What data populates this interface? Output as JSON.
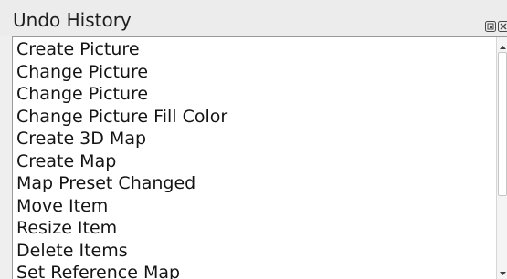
{
  "panel": {
    "title": "Undo History",
    "float_icon": "float-icon",
    "close_icon": "close-icon"
  },
  "history": {
    "items": [
      "Create Picture",
      "Change Picture",
      "Change Picture",
      "Change Picture Fill Color",
      "Create 3D Map",
      "Create Map",
      "Map Preset Changed",
      "Move Item",
      "Resize Item",
      "Delete Items",
      "Set Reference Map"
    ]
  },
  "scrollbar": {
    "up_icon": "arrow-up-icon",
    "down_icon": "arrow-down-icon"
  }
}
